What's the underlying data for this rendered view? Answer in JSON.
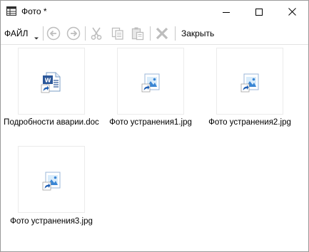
{
  "window": {
    "title": "Фото *"
  },
  "toolbar": {
    "file_menu_label": "ФАЙЛ",
    "close_label": "Закрыть"
  },
  "icons": {
    "app": "table-icon",
    "back": "back-arrow-icon",
    "forward": "forward-arrow-icon",
    "cut": "scissors-icon",
    "copy": "copy-icon",
    "paste": "paste-icon",
    "delete": "delete-x-icon"
  },
  "files": [
    {
      "label": "Подробности аварии.doc",
      "icon": "word-doc-shortcut-icon"
    },
    {
      "label": "Фото устранения1.jpg",
      "icon": "image-shortcut-icon"
    },
    {
      "label": "Фото устранения2.jpg",
      "icon": "image-shortcut-icon"
    },
    {
      "label": "Фото устранения3.jpg",
      "icon": "image-shortcut-icon"
    }
  ],
  "colors": {
    "doc_blue": "#2b579a",
    "shortcut_arrow": "#1f5fb4",
    "image_blue": "#3a86d4",
    "disabled_gray": "#bdbdbd"
  }
}
